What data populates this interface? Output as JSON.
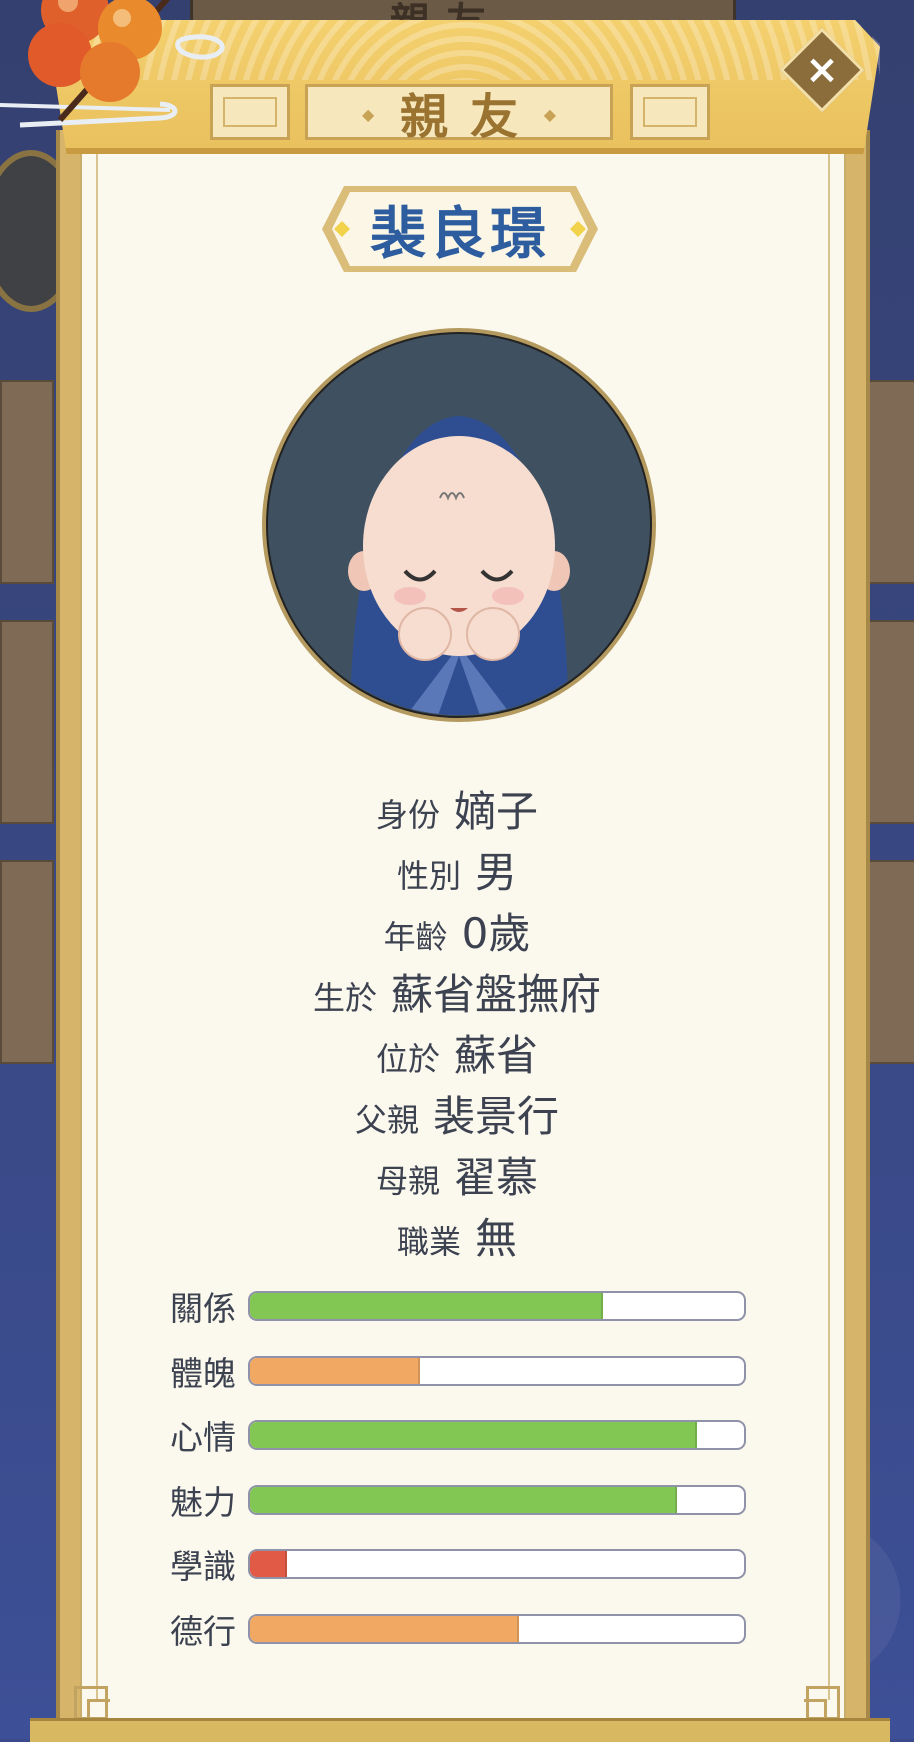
{
  "background": {
    "top_tab_text": "親友"
  },
  "header": {
    "title": "親友",
    "close_label": "×"
  },
  "profile": {
    "name": "裴良璟",
    "info": [
      {
        "label": "身份",
        "value": "嫡子"
      },
      {
        "label": "性別",
        "value": "男"
      },
      {
        "label": "年齡",
        "value": "0歲"
      },
      {
        "label": "生於",
        "value": "蘇省盤撫府"
      },
      {
        "label": "位於",
        "value": "蘇省"
      },
      {
        "label": "父親",
        "value": "裴景行"
      },
      {
        "label": "母親",
        "value": "翟慕"
      },
      {
        "label": "職業",
        "value": "無"
      }
    ],
    "stats": [
      {
        "label": "關係",
        "level_pct": 71,
        "color": "#82c654"
      },
      {
        "label": "體魄",
        "level_pct": 34,
        "color": "#f0a863"
      },
      {
        "label": "心情",
        "level_pct": 90,
        "color": "#82c654"
      },
      {
        "label": "魅力",
        "level_pct": 86,
        "color": "#82c654"
      },
      {
        "label": "學識",
        "level_pct": 7,
        "color": "#e05a45"
      },
      {
        "label": "德行",
        "level_pct": 54,
        "color": "#f0a863"
      }
    ]
  },
  "colors": {
    "accent_blue": "#2d5d9f",
    "gold": "#c8a356",
    "paper": "#fbf8ee"
  }
}
